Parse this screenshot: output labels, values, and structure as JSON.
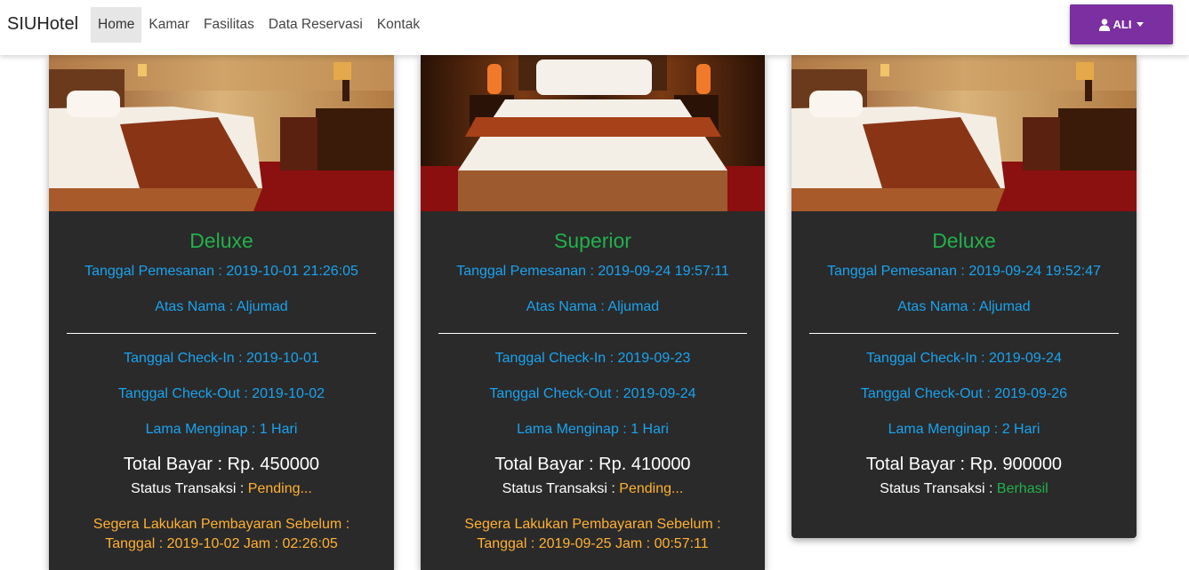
{
  "navbar": {
    "brand": "SIUHotel",
    "links": [
      {
        "label": "Home",
        "active": true
      },
      {
        "label": "Kamar"
      },
      {
        "label": "Fasilitas"
      },
      {
        "label": "Data Reservasi"
      },
      {
        "label": "Kontak"
      }
    ],
    "user_label": "ALI",
    "user_icon": "user-icon",
    "accent": "#7b2fa0"
  },
  "colors": {
    "room_type": "#22b14c",
    "info_text": "#1aa3ef",
    "pending": "#ffb133",
    "success": "#22b14c",
    "card_bg": "#2a2a2a"
  },
  "cards": [
    {
      "room_type": "Deluxe",
      "tanggal_pemesanan": "Tanggal Pemesanan : 2019-10-01 21:26:05",
      "atas_nama": "Atas Nama : Aljumad",
      "checkin": "Tanggal Check-In : 2019-10-01",
      "checkout": "Tanggal Check-Out : 2019-10-02",
      "lama": "Lama Menginap : 1 Hari",
      "total": "Total Bayar : Rp. 450000",
      "status_label": "Status Transaksi : ",
      "status_value": "Pending...",
      "warning_line1": "Segera Lakukan Pembayaran Sebelum :",
      "warning_line2": "Tanggal : 2019-10-02 Jam : 02:26:05"
    },
    {
      "room_type": "Superior",
      "tanggal_pemesanan": "Tanggal Pemesanan : 2019-09-24 19:57:11",
      "atas_nama": "Atas Nama : Aljumad",
      "checkin": "Tanggal Check-In : 2019-09-23",
      "checkout": "Tanggal Check-Out : 2019-09-24",
      "lama": "Lama Menginap : 1 Hari",
      "total": "Total Bayar : Rp. 410000",
      "status_label": "Status Transaksi : ",
      "status_value": "Pending...",
      "warning_line1": "Segera Lakukan Pembayaran Sebelum :",
      "warning_line2": "Tanggal : 2019-09-25 Jam : 00:57:11"
    },
    {
      "room_type": "Deluxe",
      "tanggal_pemesanan": "Tanggal Pemesanan : 2019-09-24 19:52:47",
      "atas_nama": "Atas Nama : Aljumad",
      "checkin": "Tanggal Check-In : 2019-09-24",
      "checkout": "Tanggal Check-Out : 2019-09-26",
      "lama": "Lama Menginap : 2 Hari",
      "total": "Total Bayar : Rp. 900000",
      "status_label": "Status Transaksi : ",
      "status_value": "Berhasil"
    }
  ]
}
